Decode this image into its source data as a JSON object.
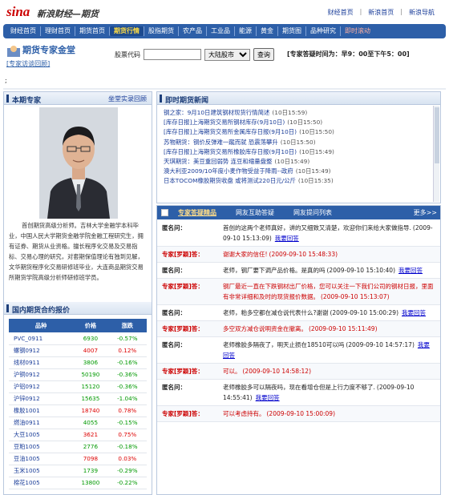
{
  "header": {
    "logo": "sina",
    "site_name": "新浪财经—期货",
    "links": [
      "财经首页",
      "新浪首页",
      "新浪导航"
    ]
  },
  "nav": [
    {
      "label": "财经首页",
      "style": "normal"
    },
    {
      "label": "理财首页",
      "style": "normal"
    },
    {
      "label": "期货首页",
      "style": "normal"
    },
    {
      "label": "期货行情",
      "style": "highlight"
    },
    {
      "label": "股指期货",
      "style": "normal"
    },
    {
      "label": "农产品",
      "style": "normal"
    },
    {
      "label": "工业品",
      "style": "normal"
    },
    {
      "label": "能源",
      "style": "normal"
    },
    {
      "label": "黄金",
      "style": "normal"
    },
    {
      "label": "期货图",
      "style": "normal"
    },
    {
      "label": "品种研究",
      "style": "normal"
    },
    {
      "label": "即时滚动",
      "style": "red"
    }
  ],
  "brand": {
    "title": "期货专家金堂",
    "subtitle": "[专家访谈回顾]"
  },
  "search": {
    "label": "股票代码",
    "market_value": "大陆股市",
    "query_label": "查询"
  },
  "trading_hours": "[专家答疑时间为：早9：00至下午5：00]",
  "semicolon": ";",
  "expert": {
    "header": "本期专家",
    "more": "坐堂实录回顾",
    "bio": "首创期货高级分析师。吉林大学金融学本科毕业，中国人民大学期货金融学院金融工程研究生，拥有证券、期货从业资格。擅长程序化交易及交易指标、交易心理的研究，对套期保值理论有独到见解，文华期货程序化交易研修班毕业，大连商品期货交易所期货学院高级分析师研修班学员。"
  },
  "prices": {
    "header": "国内期货合约报价",
    "columns": [
      "品种",
      "价格",
      "涨跌"
    ],
    "rows": [
      {
        "name": "PVC_0911",
        "price": "6930",
        "change": "-0.57%",
        "dir": "down"
      },
      {
        "name": "螺钢0912",
        "price": "4007",
        "change": "0.12%",
        "dir": "up"
      },
      {
        "name": "线材0911",
        "price": "3806",
        "change": "-0.16%",
        "dir": "down"
      },
      {
        "name": "沪铜0912",
        "price": "50190",
        "change": "-0.36%",
        "dir": "down"
      },
      {
        "name": "沪铝0912",
        "price": "15120",
        "change": "-0.36%",
        "dir": "down"
      },
      {
        "name": "沪锌0912",
        "price": "15635",
        "change": "-1.04%",
        "dir": "down"
      },
      {
        "name": "橡胶1001",
        "price": "18740",
        "change": "0.78%",
        "dir": "up"
      },
      {
        "name": "燃油0911",
        "price": "4055",
        "change": "-0.15%",
        "dir": "down"
      },
      {
        "name": "大豆1005",
        "price": "3621",
        "change": "0.75%",
        "dir": "up"
      },
      {
        "name": "豆粕1005",
        "price": "2776",
        "change": "-0.18%",
        "dir": "down"
      },
      {
        "name": "豆油1005",
        "price": "7098",
        "change": "0.03%",
        "dir": "up"
      },
      {
        "name": "玉米1005",
        "price": "1739",
        "change": "-0.29%",
        "dir": "down"
      },
      {
        "name": "棉花1005",
        "price": "13800",
        "change": "-0.22%",
        "dir": "down"
      }
    ]
  },
  "news": {
    "header": "即时期货新闻",
    "items": [
      {
        "title": "钢之家：9月10日建筑钢材现货行情简述",
        "time": "(10日15:59)"
      },
      {
        "title": "[库存日报]上海期货交易所钢材库存(9月10日)",
        "time": "(10日15:50)"
      },
      {
        "title": "[库存日报]上海期货交易所金属库存日报(9月10日)",
        "time": "(10日15:50)"
      },
      {
        "title": "苏物期货：钢价反弹难一蹴而就 恐震荡攀升",
        "time": "(10日15:50)"
      },
      {
        "title": "[库存日报]上海期货交易所橡胶库存日报(9月10日)",
        "time": "(10日15:49)"
      },
      {
        "title": "天琪期货：美豆重回弱势 连豆和缩量盘整",
        "time": "(10日15:49)"
      },
      {
        "title": "澳大利亚2009/10年度小麦作物受益于降雨--政府",
        "time": "(10日15:49)"
      },
      {
        "title": "日本TOCOM橡胶期货收盘 或将测试220日元/公斤",
        "time": "(10日15:35)"
      }
    ]
  },
  "qa": {
    "tabs": [
      "专家答疑精品",
      "网友互助答疑",
      "网友提问列表"
    ],
    "more": "更多>>",
    "reply_label": "我要回答",
    "items": [
      {
        "type": "q",
        "who": "匿名问：",
        "text": "首创的这两个老师真好，讲的又细致又清楚，欢迎你们来给大家做指导.",
        "ts": "(2009-09-10 15:13:09)"
      },
      {
        "type": "a",
        "who": "专家[罗颖]答：",
        "text": "谢谢大家的信任!",
        "ts": "(2009-09-10 15:48:33)"
      },
      {
        "type": "q",
        "who": "匿名问：",
        "text": "老师，钢厂要下调产品价格。是真的吗",
        "ts": "(2009-09-10 15:10:40)"
      },
      {
        "type": "a",
        "who": "专家[罗颖]答：",
        "text": "钢厂最近一直在下跌钢材出厂价格，您可以关注一下我们公司的钢材日报，里面有非常详细和及时的现货报价数据。",
        "ts": "(2009-09-10 15:13:07)"
      },
      {
        "type": "q",
        "who": "匿名问：",
        "text": "老师，粕多空都在减仓说代表什么?谢谢",
        "ts": "(2009-09-10 15:00:29)"
      },
      {
        "type": "a",
        "who": "专家[罗颖]答：",
        "text": "多空双方减仓说明资金在撤离。",
        "ts": "(2009-09-10 15:11:49)"
      },
      {
        "type": "q",
        "who": "匿名问：",
        "text": "老师橡胶多隔夜了，明天止损在18510可以吗",
        "ts": "(2009-09-10 14:57:17)"
      },
      {
        "type": "a",
        "who": "专家[罗颖]答：",
        "text": "可以。",
        "ts": "(2009-09-10 14:58:12)"
      },
      {
        "type": "q",
        "who": "匿名问：",
        "text": "老师橡胶多可以隔夜吗，现在看增仓但是上行力度不够了.",
        "ts": "(2009-09-10 14:55:41)"
      },
      {
        "type": "a",
        "who": "专家[罗颖]答：",
        "text": "可以考虑持有。",
        "ts": "(2009-09-10 15:00:09)"
      }
    ]
  }
}
